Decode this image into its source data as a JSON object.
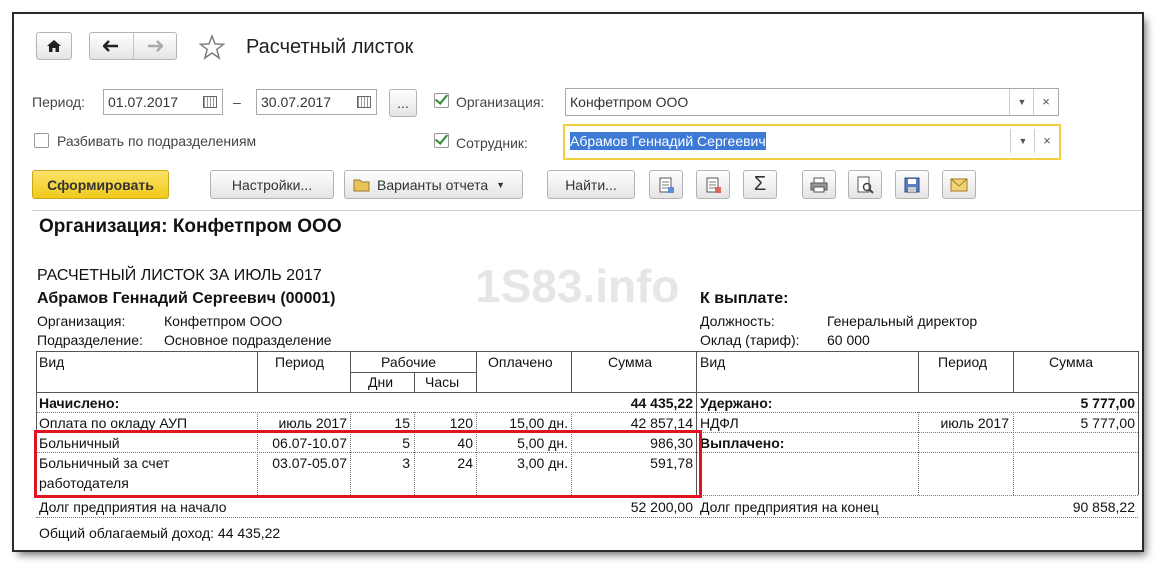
{
  "window": {
    "title": "Расчетный листок"
  },
  "nav": {
    "home_icon": "home-icon",
    "back_icon": "arrow-left-icon",
    "forward_icon": "arrow-right-icon",
    "favorite_icon": "star-icon"
  },
  "filters": {
    "period_label": "Период:",
    "date_from": "01.07.2017",
    "dash": "–",
    "date_to": "30.07.2017",
    "ellipsis": "...",
    "split_label": "Разбивать по подразделениям",
    "org_label": "Организация:",
    "org_value": "Конфетпром ООО",
    "emp_label": "Сотрудник:",
    "emp_value": "Абрамов Геннадий Сергеевич",
    "clear_symbol": "×"
  },
  "toolbar": {
    "generate": "Сформировать",
    "settings": "Настройки...",
    "variants": "Варианты отчета",
    "find": "Найти...",
    "sigma": "Σ"
  },
  "report": {
    "org_header": "Организация: Конфетпром ООО",
    "title": "РАСЧЕТНЫЙ ЛИСТОК ЗА ИЮЛЬ 2017",
    "employee": "Абрамов Геннадий Сергеевич (00001)",
    "to_pay_label": "К выплате:",
    "org_field_label": "Организация:",
    "org_field_value": "Конфетпром ООО",
    "dept_label": "Подразделение:",
    "dept_value": "Основное подразделение",
    "position_label": "Должность:",
    "position_value": "Генеральный директор",
    "salary_label": "Оклад (тариф):",
    "salary_value": "60 000",
    "watermark": "1S83.info",
    "headers": {
      "vid": "Вид",
      "period": "Период",
      "work": "Рабочие",
      "days": "Дни",
      "hours": "Часы",
      "paid": "Оплачено",
      "sum": "Сумма",
      "vid2": "Вид",
      "period2": "Период",
      "sum2": "Сумма"
    },
    "accrued_label": "Начислено:",
    "accrued_total": "44 435,22",
    "withheld_label": "Удержано:",
    "withheld_total": "5 777,00",
    "paid_out_label": "Выплачено:",
    "rows": [
      {
        "vid": "Оплата по окладу АУП",
        "period": "июль 2017",
        "days": "15",
        "hours": "120",
        "paid": "15,00 дн.",
        "sum": "42 857,14"
      },
      {
        "vid": "Больничный",
        "period": "06.07-10.07",
        "days": "5",
        "hours": "40",
        "paid": "5,00 дн.",
        "sum": "986,30"
      },
      {
        "vid": "Больничный за счет",
        "vid_line2": "работодателя",
        "period": "03.07-05.07",
        "days": "3",
        "hours": "24",
        "paid": "3,00 дн.",
        "sum": "591,78"
      }
    ],
    "deductions": [
      {
        "vid": "НДФЛ",
        "period": "июль 2017",
        "sum": "5 777,00"
      }
    ],
    "debt_start_label": "Долг предприятия на начало",
    "debt_start_value": "52 200,00",
    "debt_end_label": "Долг предприятия на конец",
    "debt_end_value": "90 858,22",
    "taxable_income": "Общий облагаемый доход: 44 435,22"
  },
  "colors": {
    "primary_button": "#f5d32e",
    "highlight_box": "#e0141e",
    "selection": "#3d7ad6",
    "employee_field_border": "#f0d040"
  }
}
